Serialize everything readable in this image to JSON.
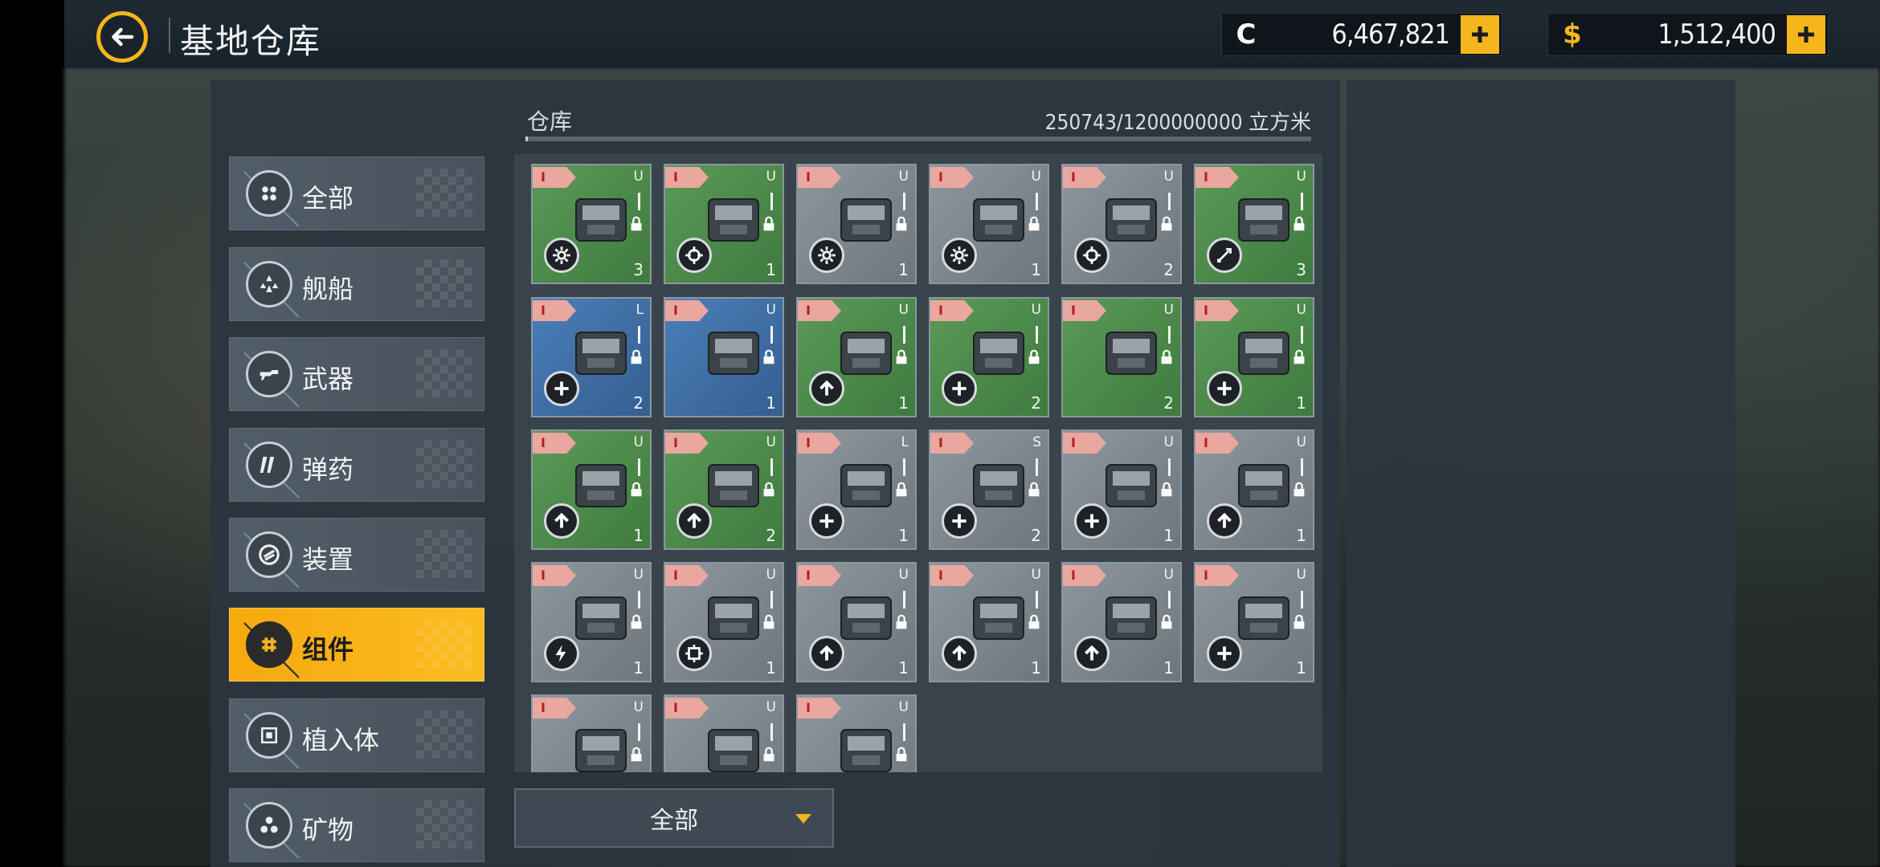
{
  "header": {
    "title": "基地仓库",
    "currencies": [
      {
        "icon": "credits-c-icon",
        "symbol": "C",
        "value": "6,467,821",
        "color": "#ffffff"
      },
      {
        "icon": "dollar-icon",
        "symbol": "$",
        "value": "1,512,400",
        "color": "#f4b61c"
      }
    ]
  },
  "sidebar": {
    "categories": [
      {
        "label": "全部",
        "icon": "grid-dots-icon",
        "active": false
      },
      {
        "label": "舰船",
        "icon": "ships-icon",
        "active": false
      },
      {
        "label": "武器",
        "icon": "weapon-icon",
        "active": false
      },
      {
        "label": "弹药",
        "icon": "ammo-icon",
        "active": false
      },
      {
        "label": "装置",
        "icon": "device-icon",
        "active": false
      },
      {
        "label": "组件",
        "icon": "component-icon",
        "active": true
      },
      {
        "label": "植入体",
        "icon": "implant-icon",
        "active": false
      },
      {
        "label": "矿物",
        "icon": "mineral-icon",
        "active": false
      }
    ]
  },
  "warehouse": {
    "label": "仓库",
    "capacity": "250743/1200000000 立方米",
    "fill_fraction": 0.0002
  },
  "items": [
    {
      "tier": "I",
      "size": "U",
      "qty": "3",
      "bg": "green",
      "action": "gear-icon",
      "color": "#5a9a57"
    },
    {
      "tier": "I",
      "size": "U",
      "qty": "1",
      "bg": "green",
      "action": "crosshair-icon",
      "color": "#5a9a57"
    },
    {
      "tier": "I",
      "size": "U",
      "qty": "1",
      "bg": "grey",
      "action": "gear-icon",
      "color": "#8e979e"
    },
    {
      "tier": "I",
      "size": "U",
      "qty": "1",
      "bg": "grey",
      "action": "gear-icon",
      "color": "#8e979e"
    },
    {
      "tier": "I",
      "size": "U",
      "qty": "2",
      "bg": "grey",
      "action": "crosshair-icon",
      "color": "#8e979e"
    },
    {
      "tier": "I",
      "size": "U",
      "qty": "3",
      "bg": "green",
      "action": "missile-icon",
      "color": "#5a9a57"
    },
    {
      "tier": "I",
      "size": "L",
      "qty": "2",
      "bg": "blue",
      "action": "plus-circle-icon",
      "color": "#4b7fb8"
    },
    {
      "tier": "I",
      "size": "U",
      "qty": "1",
      "bg": "blue",
      "action": "none",
      "color": "#4b7fb8"
    },
    {
      "tier": "I",
      "size": "U",
      "qty": "1",
      "bg": "green",
      "action": "arrow-up-icon",
      "color": "#5a9a57"
    },
    {
      "tier": "I",
      "size": "U",
      "qty": "2",
      "bg": "green",
      "action": "plus-circle-icon",
      "color": "#5a9a57"
    },
    {
      "tier": "I",
      "size": "U",
      "qty": "2",
      "bg": "green",
      "action": "none",
      "color": "#5a9a57"
    },
    {
      "tier": "I",
      "size": "U",
      "qty": "1",
      "bg": "green",
      "action": "plus-circle-icon",
      "color": "#5a9a57"
    },
    {
      "tier": "I",
      "size": "U",
      "qty": "1",
      "bg": "green",
      "action": "arrow-up-icon",
      "color": "#5a9a57"
    },
    {
      "tier": "I",
      "size": "U",
      "qty": "2",
      "bg": "green",
      "action": "arrow-up-icon",
      "color": "#5a9a57"
    },
    {
      "tier": "I",
      "size": "L",
      "qty": "1",
      "bg": "grey",
      "action": "plus-circle-icon",
      "color": "#8e979e"
    },
    {
      "tier": "I",
      "size": "S",
      "qty": "2",
      "bg": "grey",
      "action": "plus-circle-icon",
      "color": "#8e979e"
    },
    {
      "tier": "I",
      "size": "U",
      "qty": "1",
      "bg": "grey",
      "action": "plus-circle-icon",
      "color": "#8e979e"
    },
    {
      "tier": "I",
      "size": "U",
      "qty": "1",
      "bg": "grey",
      "action": "arrow-up-icon",
      "color": "#8e979e"
    },
    {
      "tier": "I",
      "size": "U",
      "qty": "1",
      "bg": "grey",
      "action": "lightning-icon",
      "color": "#8e979e"
    },
    {
      "tier": "I",
      "size": "U",
      "qty": "1",
      "bg": "grey",
      "action": "target-square-icon",
      "color": "#8e979e"
    },
    {
      "tier": "I",
      "size": "U",
      "qty": "1",
      "bg": "grey",
      "action": "arrow-up-icon",
      "color": "#8e979e"
    },
    {
      "tier": "I",
      "size": "U",
      "qty": "1",
      "bg": "grey",
      "action": "arrow-up-icon",
      "color": "#8e979e"
    },
    {
      "tier": "I",
      "size": "U",
      "qty": "1",
      "bg": "grey",
      "action": "arrow-up-icon",
      "color": "#8e979e"
    },
    {
      "tier": "I",
      "size": "U",
      "qty": "1",
      "bg": "grey",
      "action": "plus-circle-icon",
      "color": "#8e979e"
    },
    {
      "tier": "I",
      "size": "U",
      "qty": "",
      "bg": "grey",
      "action": "none",
      "color": "#8e979e"
    },
    {
      "tier": "I",
      "size": "U",
      "qty": "",
      "bg": "grey",
      "action": "none",
      "color": "#8e979e"
    },
    {
      "tier": "I",
      "size": "U",
      "qty": "",
      "bg": "grey",
      "action": "none",
      "color": "#8e979e"
    }
  ],
  "filter": {
    "selected": "全部"
  },
  "colors": {
    "accent": "#f4b61c",
    "panel": "#2c353e"
  }
}
